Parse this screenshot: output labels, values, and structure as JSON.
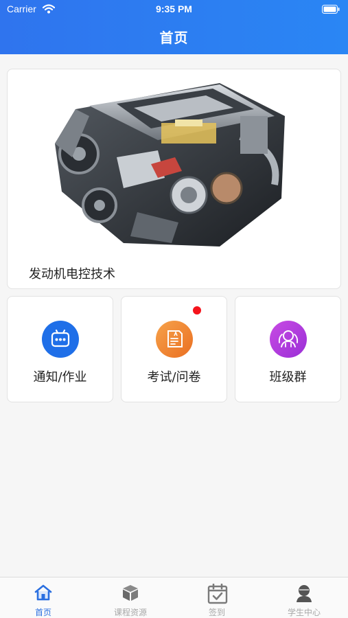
{
  "status_bar": {
    "carrier": "Carrier",
    "time": "9:35 PM"
  },
  "header": {
    "title": "首页"
  },
  "course": {
    "title": "发动机电控技术",
    "image_icon": "car-engine-illustration"
  },
  "tiles": [
    {
      "label": "通知/作业",
      "icon": "message-dots-icon",
      "color": "#1f6fe8",
      "badge": false
    },
    {
      "label": "考试/问卷",
      "icon": "exam-paper-icon",
      "color": "#f08a33",
      "badge": true
    },
    {
      "label": "班级群",
      "icon": "group-icon",
      "color": "#b43bdc",
      "badge": false
    }
  ],
  "tabbar": {
    "items": [
      {
        "label": "首页",
        "icon": "home-icon",
        "active": true
      },
      {
        "label": "课程资源",
        "icon": "cube-icon",
        "active": false
      },
      {
        "label": "签到",
        "icon": "calendar-check-icon",
        "active": false
      },
      {
        "label": "学生中心",
        "icon": "user-icon",
        "active": false
      }
    ],
    "active_color": "#2a6fe0",
    "inactive_color": "#a8a8a8"
  },
  "colors": {
    "header": "#2f74ee",
    "badge": "#f5141c"
  }
}
